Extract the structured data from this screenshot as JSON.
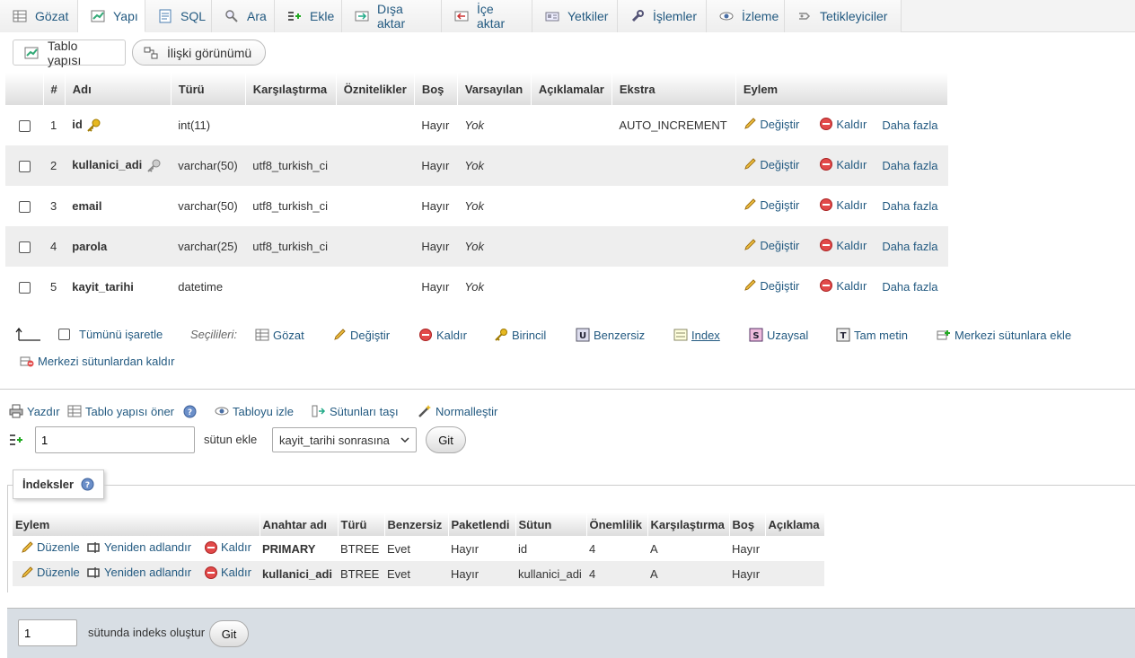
{
  "tabs": [
    {
      "label": "Gözat",
      "icon": "browse-icon"
    },
    {
      "label": "Yapı",
      "icon": "structure-icon"
    },
    {
      "label": "SQL",
      "icon": "sql-icon"
    },
    {
      "label": "Ara",
      "icon": "search-icon"
    },
    {
      "label": "Ekle",
      "icon": "insert-icon"
    },
    {
      "label": "Dışa aktar",
      "icon": "export-icon"
    },
    {
      "label": "İçe aktar",
      "icon": "import-icon"
    },
    {
      "label": "Yetkiler",
      "icon": "privileges-icon"
    },
    {
      "label": "İşlemler",
      "icon": "operations-icon"
    },
    {
      "label": "İzleme",
      "icon": "tracking-icon"
    },
    {
      "label": "Tetikleyiciler",
      "icon": "triggers-icon"
    }
  ],
  "subtabs": {
    "structure": "Tablo yapısı",
    "relation": "İlişki görünümü"
  },
  "structure": {
    "headers": [
      "#",
      "Adı",
      "Türü",
      "Karşılaştırma",
      "Öznitelikler",
      "Boş",
      "Varsayılan",
      "Açıklamalar",
      "Ekstra",
      "Eylem"
    ],
    "rows": [
      {
        "num": "1",
        "name": "id",
        "type": "int(11)",
        "collation": "",
        "attributes": "",
        "null": "Hayır",
        "default": "Yok",
        "comments": "",
        "extra": "AUTO_INCREMENT"
      },
      {
        "num": "2",
        "name": "kullanici_adi",
        "type": "varchar(50)",
        "collation": "utf8_turkish_ci",
        "attributes": "",
        "null": "Hayır",
        "default": "Yok",
        "comments": "",
        "extra": ""
      },
      {
        "num": "3",
        "name": "email",
        "type": "varchar(50)",
        "collation": "utf8_turkish_ci",
        "attributes": "",
        "null": "Hayır",
        "default": "Yok",
        "comments": "",
        "extra": ""
      },
      {
        "num": "4",
        "name": "parola",
        "type": "varchar(25)",
        "collation": "utf8_turkish_ci",
        "attributes": "",
        "null": "Hayır",
        "default": "Yok",
        "comments": "",
        "extra": ""
      },
      {
        "num": "5",
        "name": "kayit_tarihi",
        "type": "datetime",
        "collation": "",
        "attributes": "",
        "null": "Hayır",
        "default": "Yok",
        "comments": "",
        "extra": ""
      }
    ],
    "actions": {
      "change": "Değiştir",
      "drop": "Kaldır",
      "more": "Daha fazla"
    }
  },
  "bulk": {
    "check_all": "Tümünü işaretle",
    "with_selected": "Seçilileri:",
    "browse": "Gözat",
    "change": "Değiştir",
    "drop": "Kaldır",
    "primary": "Birincil",
    "unique": "Benzersiz",
    "index": "Index",
    "spatial": "Uzaysal",
    "fulltext": "Tam metin",
    "add_central": "Merkezi sütunlara ekle",
    "remove_central": "Merkezi sütunlardan kaldır"
  },
  "tools": {
    "print": "Yazdır",
    "propose": "Tablo yapısı öner",
    "track": "Tabloyu izle",
    "move": "Sütunları taşı",
    "normalize": "Normalleştir"
  },
  "add_column": {
    "count": "1",
    "label": "sütun ekle",
    "position": "kayit_tarihi sonrasına",
    "go": "Git"
  },
  "indexes": {
    "title": "İndeksler",
    "headers": [
      "Eylem",
      "Anahtar adı",
      "Türü",
      "Benzersiz",
      "Paketlendi",
      "Sütun",
      "Önemlilik",
      "Karşılaştırma",
      "Boş",
      "Açıklama"
    ],
    "actions": {
      "edit": "Düzenle",
      "rename": "Yeniden adlandır",
      "drop": "Kaldır"
    },
    "rows": [
      {
        "key": "PRIMARY",
        "type": "BTREE",
        "unique": "Evet",
        "packed": "Hayır",
        "column": "id",
        "cardinality": "4",
        "collation": "A",
        "null": "Hayır",
        "comment": ""
      },
      {
        "key": "kullanici_adi",
        "type": "BTREE",
        "unique": "Evet",
        "packed": "Hayır",
        "column": "kullanici_adi",
        "cardinality": "4",
        "collation": "A",
        "null": "Hayır",
        "comment": ""
      }
    ]
  },
  "create_index": {
    "count": "1",
    "label": "sütunda indeks oluştur",
    "go": "Git"
  }
}
